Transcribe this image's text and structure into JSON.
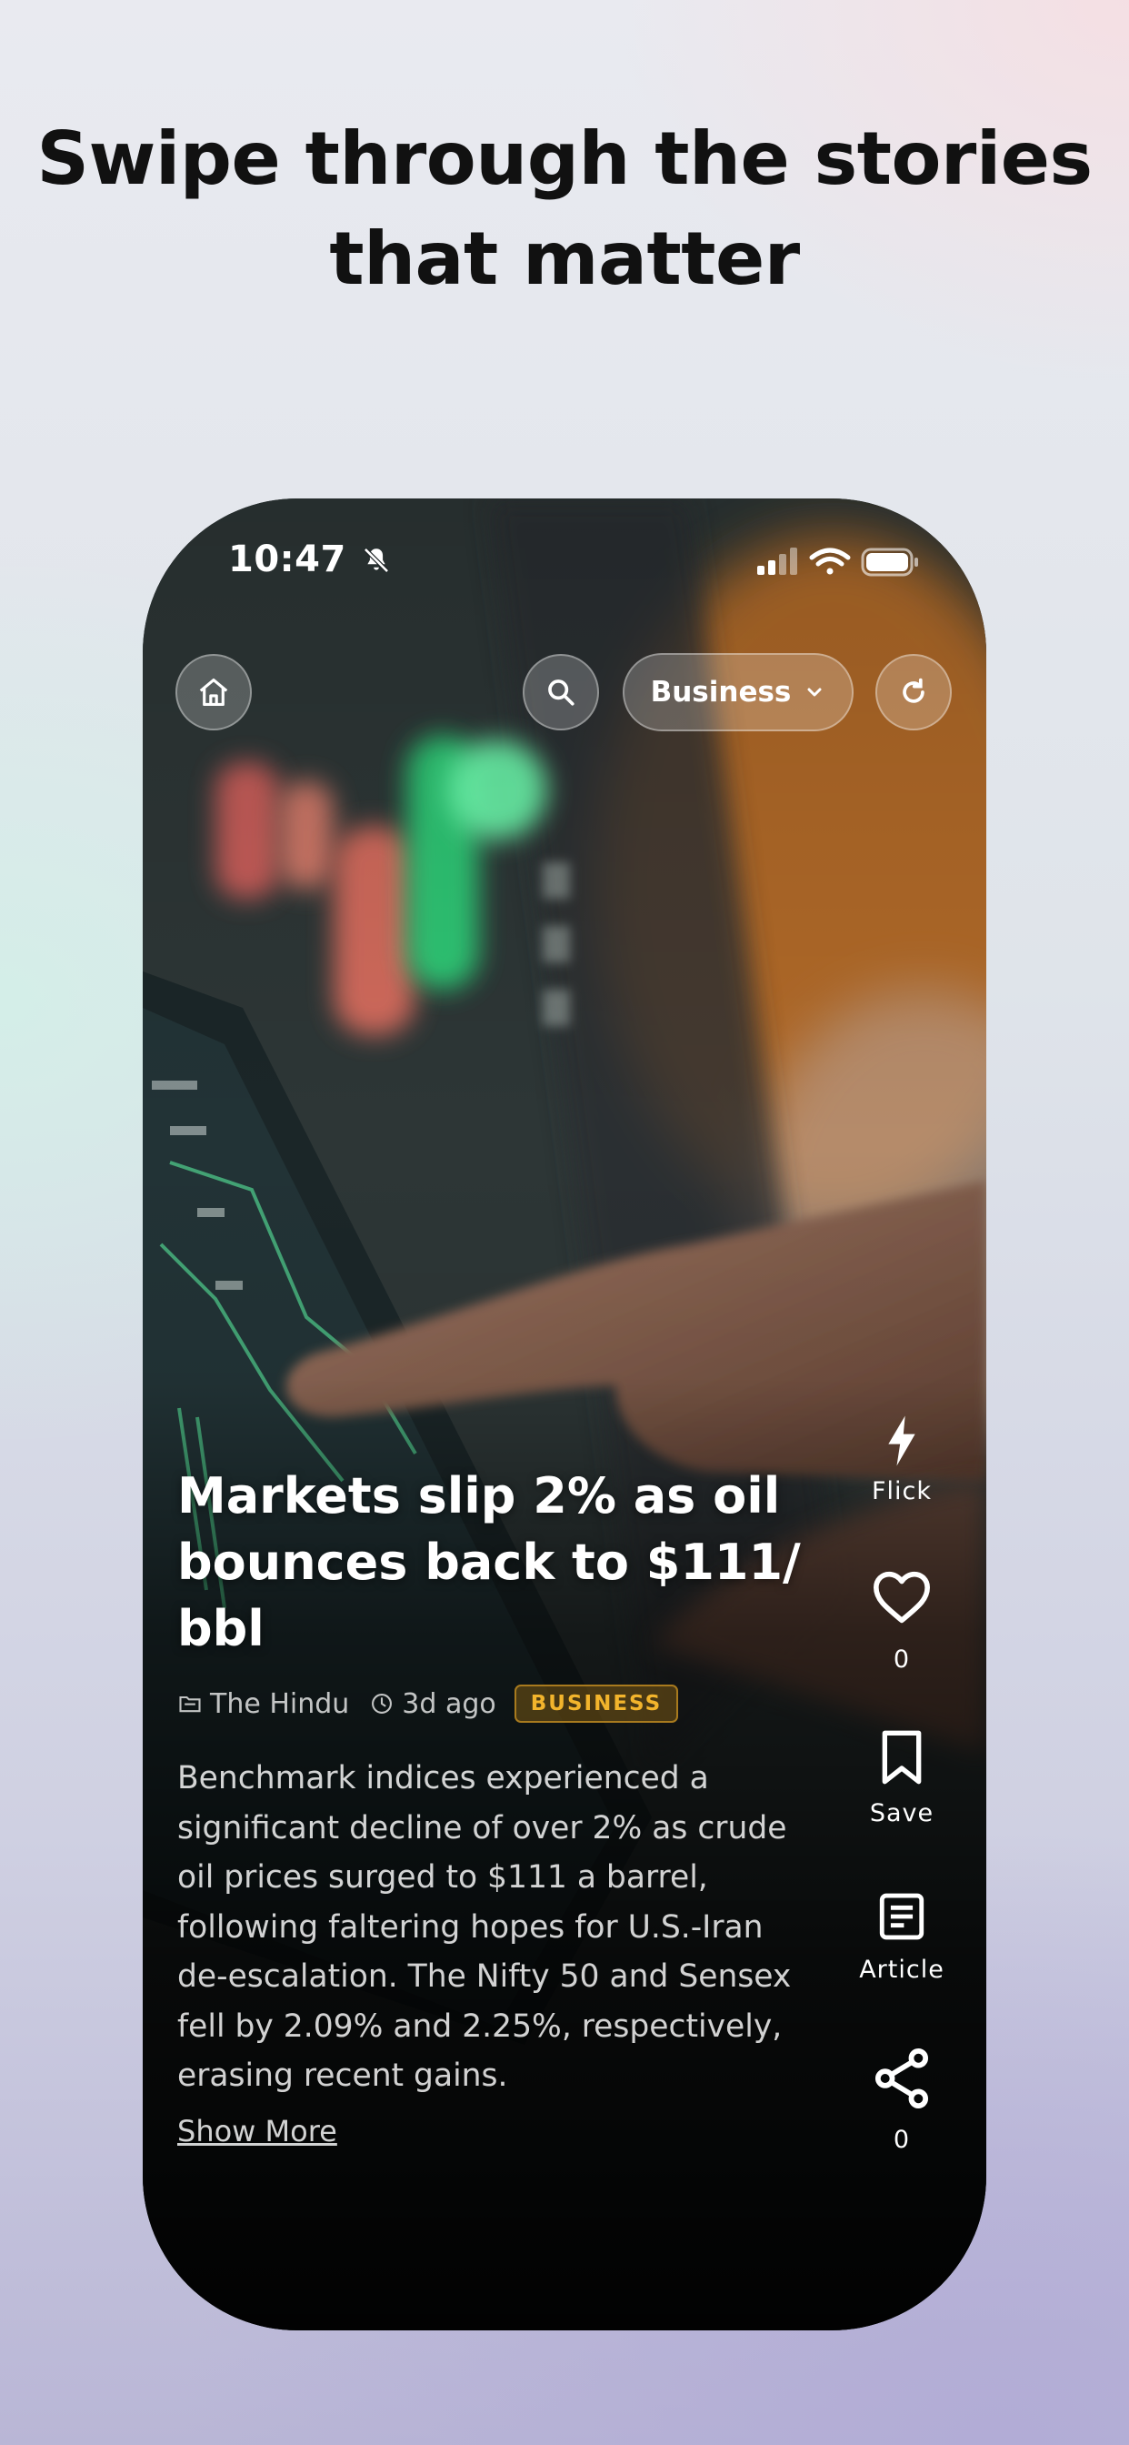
{
  "headline": {
    "line1": "Swipe through the stories",
    "line2": "that matter"
  },
  "status_bar": {
    "time": "10:47",
    "icons": [
      "bell-slash-icon",
      "cellular-signal-icon",
      "wifi-icon",
      "battery-icon"
    ]
  },
  "top_bar": {
    "home_icon": "home-icon",
    "search_icon": "search-icon",
    "category_label": "Business",
    "category_icon": "chevron-down-icon",
    "refresh_icon": "refresh-icon"
  },
  "article": {
    "title": "Markets slip 2% as oil bounces back to $111/ bbl",
    "source": "The Hindu",
    "time_ago": "3d ago",
    "category_badge": "BUSINESS",
    "description": "Benchmark indices experienced a significant decline of over 2% as crude oil prices surged to $111 a barrel, following faltering hopes for U.S.-Iran de-escalation. The Nifty 50 and Sensex fell by 2.09% and 2.25%, respectively, erasing recent gains.",
    "show_more": "Show More"
  },
  "actions": {
    "flick": {
      "icon": "lightning-icon",
      "label": "Flick"
    },
    "like": {
      "icon": "heart-icon",
      "count": "0"
    },
    "save": {
      "icon": "bookmark-icon",
      "label": "Save"
    },
    "article": {
      "icon": "document-icon",
      "label": "Article"
    },
    "share": {
      "icon": "share-icon",
      "count": "0"
    }
  },
  "colors": {
    "badge_text": "#f2b42c",
    "badge_border": "#a87a1e",
    "headline_text": "#111111"
  }
}
